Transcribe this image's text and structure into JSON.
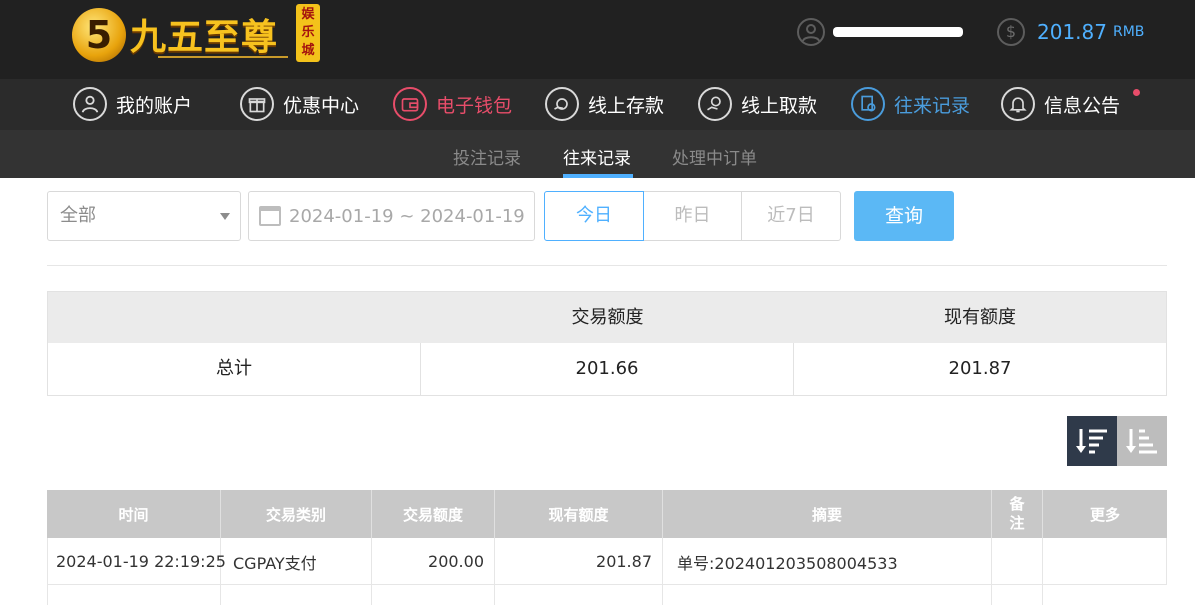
{
  "header": {
    "logo_text": "九五至尊",
    "logo_badge": "娱乐城",
    "logo_numeral": "5",
    "username_masked": "",
    "balance_amount": "201.87",
    "balance_unit": "RMB"
  },
  "nav": {
    "items": [
      {
        "label": "我的账户",
        "icon": "user-icon"
      },
      {
        "label": "优惠中心",
        "icon": "gift-icon"
      },
      {
        "label": "电子钱包",
        "icon": "wallet-icon"
      },
      {
        "label": "线上存款",
        "icon": "deposit-icon"
      },
      {
        "label": "线上取款",
        "icon": "withdraw-icon"
      },
      {
        "label": "往来记录",
        "icon": "records-icon"
      },
      {
        "label": "信息公告",
        "icon": "bell-icon"
      }
    ],
    "active": "往来记录",
    "highlight_color": "#e84d6a",
    "active_color": "#4a9cdc"
  },
  "subnav": {
    "tabs": [
      "投注记录",
      "往来记录",
      "处理中订单"
    ],
    "active": "往来记录"
  },
  "filters": {
    "type_select": "全部",
    "date_range": "2024-01-19 ~ 2024-01-19",
    "quick": [
      "今日",
      "昨日",
      "近7日"
    ],
    "quick_active": "今日",
    "search_label": "查询"
  },
  "summary": {
    "headers": [
      "",
      "交易额度",
      "现有额度"
    ],
    "row": {
      "label": "总计",
      "transaction": "201.66",
      "current": "201.87"
    }
  },
  "records": {
    "headers": [
      "时间",
      "交易类别",
      "交易额度",
      "现有额度",
      "摘要",
      "备注",
      "更多"
    ],
    "rows": [
      {
        "time": "2024-01-19 22:19:25",
        "type": "CGPAY支付",
        "amount": "200.00",
        "balance": "201.87",
        "summary": "单号:202401203508004533",
        "note": "",
        "more": ""
      }
    ]
  }
}
